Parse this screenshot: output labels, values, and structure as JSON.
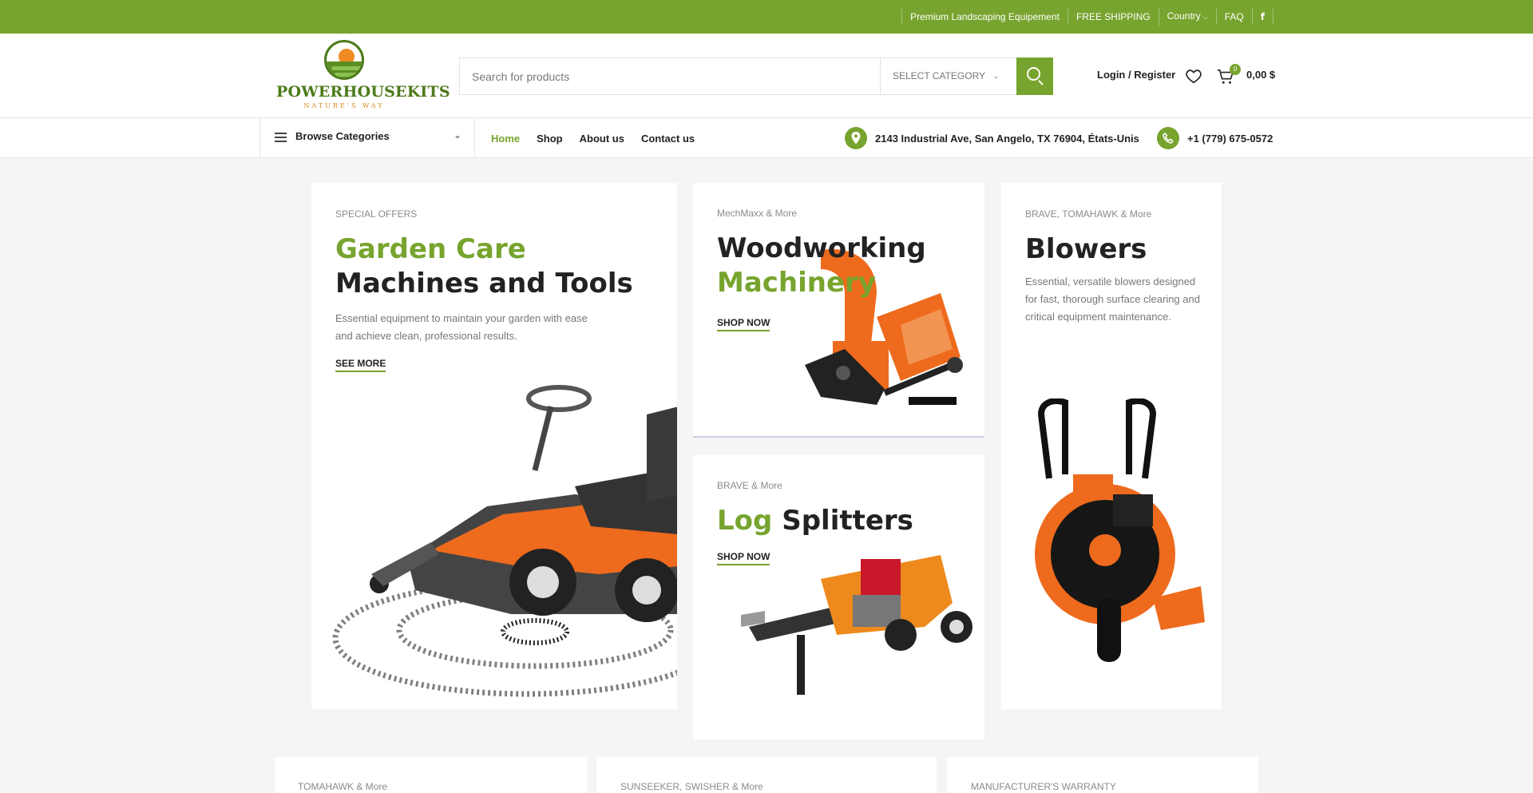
{
  "topbar": {
    "links": [
      "Premium Landscaping Equipement",
      "FREE SHIPPING",
      "Country",
      "FAQ"
    ],
    "facebook": "f"
  },
  "header": {
    "logo_brand": "POWERHOUSEKITS",
    "logo_tagline": "NATURE'S WAY",
    "search_placeholder": "Search for products",
    "category_label": "SELECT CATEGORY",
    "login_label": "Login / Register",
    "cart_count": "0",
    "cart_total": "0,00 $"
  },
  "nav": {
    "browse_label": "Browse Categories",
    "menu": [
      "Home",
      "Shop",
      "About us",
      "Contact us"
    ],
    "address": "2143 Industrial Ave, San Angelo, TX 76904, États-Unis",
    "phone": "+1 (779) 675-0572"
  },
  "cards": {
    "garden": {
      "eyebrow": "SPECIAL OFFERS",
      "title_green": "Garden Care",
      "title_dark": "Machines and Tools",
      "desc": "Essential equipment to maintain your garden with ease and achieve clean, professional results.",
      "link": "SEE MORE"
    },
    "woodworking": {
      "eyebrow": "MechMaxx & More",
      "title_dark": "Woodworking",
      "title_green": "Machinery",
      "link": "SHOP NOW"
    },
    "log": {
      "eyebrow": "BRAVE & More",
      "title_green": "Log",
      "title_dark": "Splitters",
      "link": "SHOP NOW"
    },
    "blowers": {
      "eyebrow": "BRAVE, TOMAHAWK & More",
      "title_dark": "Blowers",
      "desc": "Essential, versatile blowers designed for fast, thorough surface clearing and critical equipment maintenance."
    },
    "bottom": [
      {
        "eyebrow": "TOMAHAWK & More"
      },
      {
        "eyebrow": "SUNSEEKER, SWISHER & More"
      },
      {
        "eyebrow": "MANUFACTURER'S WARRANTY"
      }
    ]
  },
  "colors": {
    "accent": "#77a42e",
    "orange": "#ee6a1d"
  }
}
